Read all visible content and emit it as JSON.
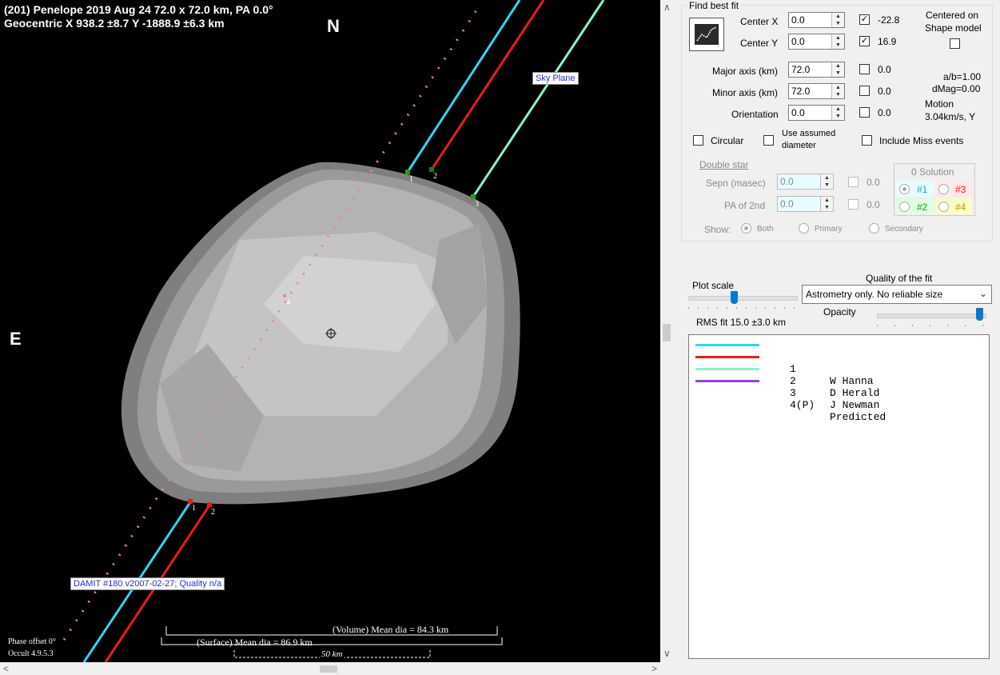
{
  "plot": {
    "title_line1": "(201) Penelope  2019 Aug 24   72.0 x 72.0 km,  PA 0.0°",
    "title_line2": "Geocentric  X  938.2 ±8.7  Y -1888.9 ±6.3 km",
    "north": "N",
    "east": "E",
    "sky_plane": "Sky Plane",
    "damit_label": "DAMIT #180 v2007-02-27; Quality n/a",
    "phase_offset": "Phase offset 0°",
    "occult": "Occult 4.9.5.3",
    "volume_mean": "(Volume) Mean dia = 84.3 km",
    "surface_mean": "(Surface) Mean dia = 86.9 km",
    "scale_bar": "50 km",
    "chord_labels": [
      "1",
      "2",
      "3",
      "4"
    ]
  },
  "panel": {
    "group_title": "Find best fit",
    "center_x_label": "Center X",
    "center_x_value": "0.0",
    "center_x_fit": "-22.8",
    "center_y_label": "Center Y",
    "center_y_value": "0.0",
    "center_y_fit": "16.9",
    "centered_on": "Centered on",
    "shape_model": "Shape model",
    "major_label": "Major axis (km)",
    "major_value": "72.0",
    "major_fit": "0.0",
    "minor_label": "Minor axis (km)",
    "minor_value": "72.0",
    "minor_fit": "0.0",
    "orient_label": "Orientation",
    "orient_value": "0.0",
    "orient_fit": "0.0",
    "ab": "a/b=1.00",
    "dmag": "dMag=0.00",
    "motion_label": "Motion",
    "motion_value": "3.04km/s, Y",
    "circular": "Circular",
    "use_assumed_1": "Use assumed",
    "use_assumed_2": "diameter",
    "include_miss": "Include Miss events",
    "double_star": "Double star",
    "sepn_label": "Sepn (masec)",
    "sepn_value": "0.0",
    "sepn_fit": "0.0",
    "pa2_label": "PA of 2nd",
    "pa2_value": "0.0",
    "pa2_fit": "0.0",
    "solution_title": "0 Solution",
    "sol1": "#1",
    "sol2": "#2",
    "sol3": "#3",
    "sol4": "#4",
    "show_label": "Show:",
    "show_both": "Both",
    "show_primary": "Primary",
    "show_secondary": "Secondary",
    "plot_scale": "Plot scale",
    "quality_label": "Quality of the fit",
    "quality_value": "Astrometry only. No reliable size",
    "opacity": "Opacity",
    "rms": "RMS fit  15.0 ±3.0 km"
  },
  "legend": [
    {
      "num": "1",
      "name": "W Hanna",
      "color": "#33d6ee"
    },
    {
      "num": "2",
      "name": "D Herald",
      "color": "#e81d1d"
    },
    {
      "num": "3",
      "name": "J Newman",
      "color": "#8ff0c8"
    },
    {
      "num": "4(P)",
      "name": "Predicted",
      "color": "#9b3fe0"
    }
  ]
}
